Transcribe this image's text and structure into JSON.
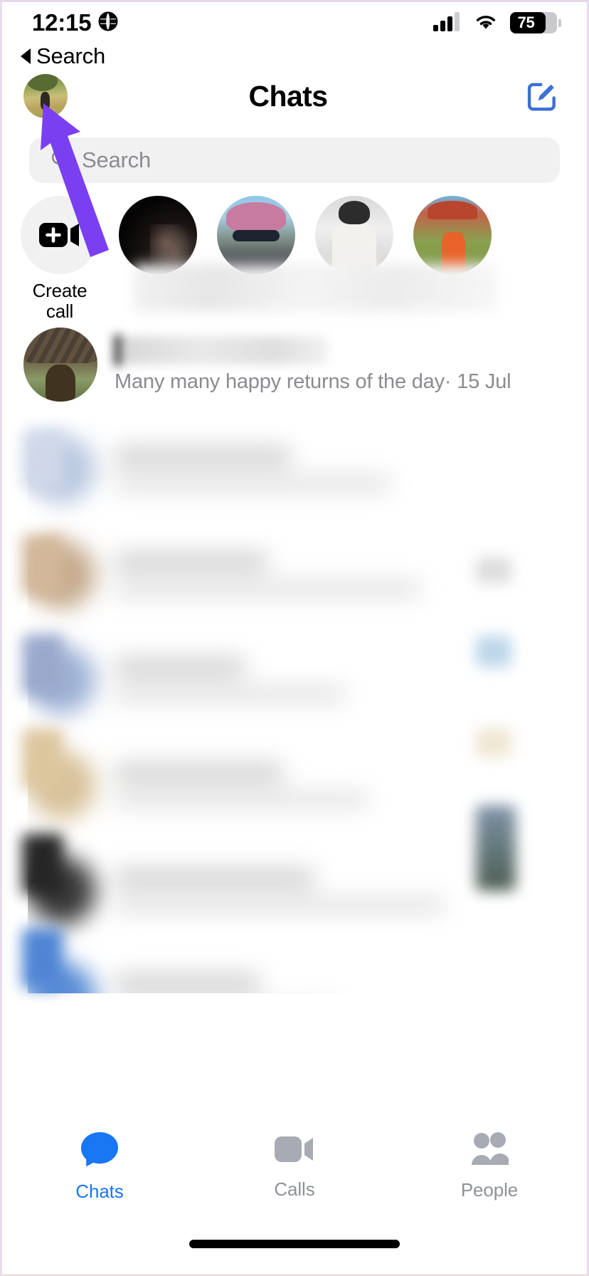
{
  "status_bar": {
    "time": "12:15",
    "location_icon": "globe-icon",
    "cellular_icon": "cellular-bars-icon",
    "wifi_icon": "wifi-icon",
    "battery_percent": "75"
  },
  "back_nav": {
    "label": "Search",
    "icon": "back-caret-icon"
  },
  "header": {
    "title": "Chats",
    "avatar_name": "profile-avatar",
    "compose_icon": "compose-edit-icon",
    "compose_color": "#3b6fd4"
  },
  "search": {
    "placeholder": "Search",
    "icon": "search-icon"
  },
  "stories": {
    "create": {
      "label_line1": "Create",
      "label_line2": "call",
      "icon": "video-camera-plus-icon"
    },
    "items": [
      {
        "name": "story-avatar-1"
      },
      {
        "name": "story-avatar-2"
      },
      {
        "name": "story-avatar-3"
      },
      {
        "name": "story-avatar-4"
      }
    ]
  },
  "chats": {
    "visible_row": {
      "name_redacted": true,
      "preview": "Many many happy returns of the day· 15 Jul"
    },
    "partial_row": {
      "name": "Priya Shah"
    }
  },
  "tab_bar": {
    "items": [
      {
        "label": "Chats",
        "icon": "chat-bubble-icon",
        "active": true
      },
      {
        "label": "Calls",
        "icon": "video-camera-icon",
        "active": false
      },
      {
        "label": "People",
        "icon": "people-icon",
        "active": false
      }
    ],
    "active_color": "#1877f2",
    "inactive_color": "#8f9299"
  },
  "annotation": {
    "arrow_color": "#7b3ff2",
    "points_to": "profile-avatar"
  }
}
